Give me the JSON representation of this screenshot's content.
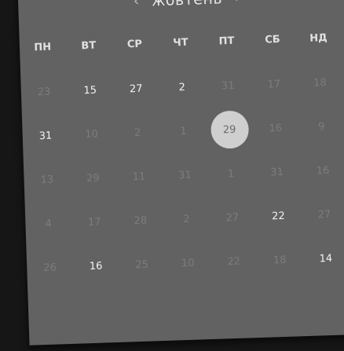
{
  "header": {
    "prev_icon": "chevron-left-icon",
    "next_icon": "chevron-right-icon",
    "prev_glyph": "‹",
    "next_glyph": "›",
    "month": "жовтень"
  },
  "weekdays": [
    "ПН",
    "ВТ",
    "СР",
    "ЧТ",
    "ПТ",
    "СБ",
    "НД"
  ],
  "colors": {
    "calendar_bg": "#626262",
    "selected_bg": "#cfcfcf",
    "muted_text": "#7c7c7c",
    "active_text": "#f2f2f2"
  },
  "days": [
    {
      "label": "23",
      "state": "muted"
    },
    {
      "label": "15",
      "state": "active"
    },
    {
      "label": "27",
      "state": "active"
    },
    {
      "label": "2",
      "state": "active"
    },
    {
      "label": "31",
      "state": "muted"
    },
    {
      "label": "17",
      "state": "muted"
    },
    {
      "label": "18",
      "state": "muted"
    },
    {
      "label": "31",
      "state": "active"
    },
    {
      "label": "10",
      "state": "muted"
    },
    {
      "label": "2",
      "state": "muted"
    },
    {
      "label": "1",
      "state": "muted"
    },
    {
      "label": "29",
      "state": "selected"
    },
    {
      "label": "16",
      "state": "muted"
    },
    {
      "label": "9",
      "state": "muted"
    },
    {
      "label": "13",
      "state": "muted"
    },
    {
      "label": "29",
      "state": "muted"
    },
    {
      "label": "11",
      "state": "muted"
    },
    {
      "label": "31",
      "state": "muted"
    },
    {
      "label": "1",
      "state": "muted"
    },
    {
      "label": "31",
      "state": "muted"
    },
    {
      "label": "16",
      "state": "muted"
    },
    {
      "label": "4",
      "state": "muted"
    },
    {
      "label": "17",
      "state": "muted"
    },
    {
      "label": "28",
      "state": "muted"
    },
    {
      "label": "2",
      "state": "muted"
    },
    {
      "label": "27",
      "state": "muted"
    },
    {
      "label": "22",
      "state": "active"
    },
    {
      "label": "27",
      "state": "muted"
    },
    {
      "label": "26",
      "state": "muted"
    },
    {
      "label": "16",
      "state": "active"
    },
    {
      "label": "25",
      "state": "muted"
    },
    {
      "label": "10",
      "state": "muted"
    },
    {
      "label": "22",
      "state": "muted"
    },
    {
      "label": "18",
      "state": "muted"
    },
    {
      "label": "14",
      "state": "active"
    }
  ]
}
